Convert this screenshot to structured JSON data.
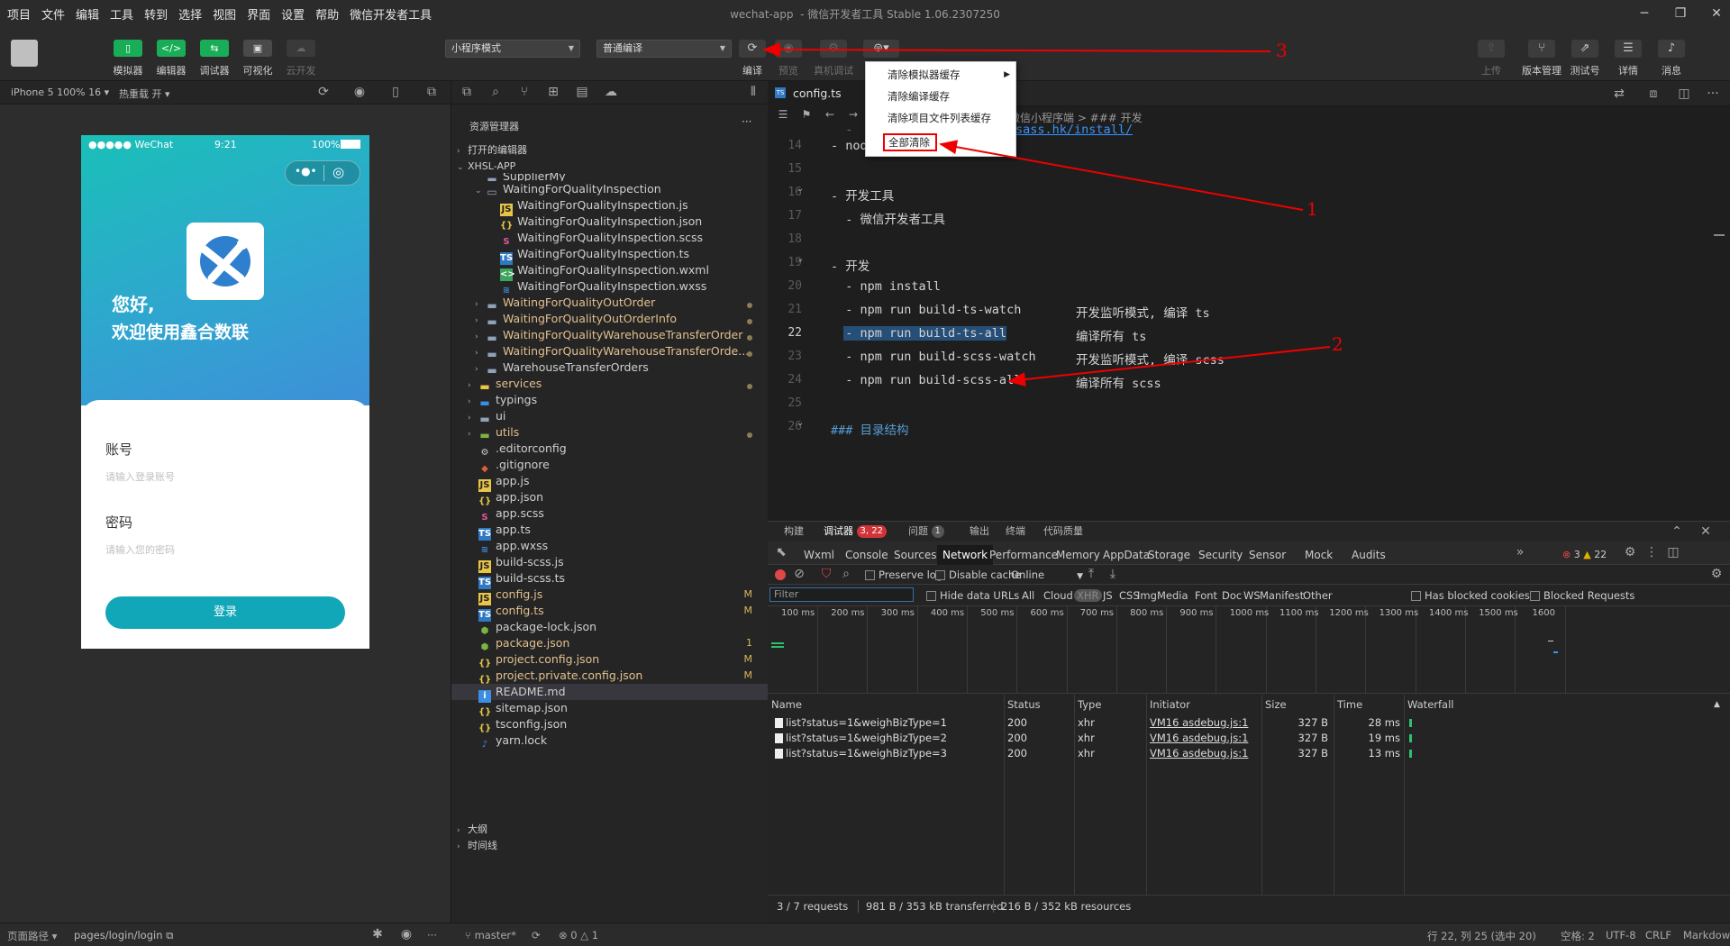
{
  "menubar": {
    "items": [
      "项目",
      "文件",
      "编辑",
      "工具",
      "转到",
      "选择",
      "视图",
      "界面",
      "设置",
      "帮助",
      "微信开发者工具"
    ]
  },
  "window_title": "wechat-app",
  "window_subtitle": "- 微信开发者工具 Stable 1.06.2307250",
  "toolbar": {
    "buttons": [
      "模拟器",
      "编辑器",
      "调试器",
      "可视化",
      "云开发"
    ],
    "mode_select": "小程序模式",
    "compile_select": "普通编译",
    "compile_label": "编译",
    "preview_label": "预览",
    "realdevice_label": "真机调试",
    "right": [
      "上传",
      "版本管理",
      "测试号",
      "详情",
      "消息"
    ]
  },
  "sim": {
    "device": "iPhone 5 100% 16",
    "hotreload": "热重载 开",
    "status_carrier": "●●●●● WeChat",
    "status_time": "9:21",
    "status_battery": "100%",
    "greeting1": "您好,",
    "greeting2": "欢迎使用鑫合数联",
    "account_label": "账号",
    "account_placeholder": "请输入登录账号",
    "password_label": "密码",
    "password_placeholder": "请输入您的密码",
    "login": "登录"
  },
  "explorer": {
    "title": "资源管理器",
    "open_editors": "打开的编辑器",
    "project": "XHSL-APP",
    "outline": "大纲",
    "timeline": "时间线"
  },
  "files": [
    {
      "name": "SupplierMy",
      "indent": 2,
      "icon": "folder",
      "cut": true
    },
    {
      "name": "WaitingForQualityInspection",
      "indent": 2,
      "icon": "folder-open",
      "tw": "v"
    },
    {
      "name": "WaitingForQualityInspection.js",
      "indent": 4,
      "icon": "js"
    },
    {
      "name": "WaitingForQualityInspection.json",
      "indent": 4,
      "icon": "json"
    },
    {
      "name": "WaitingForQualityInspection.scss",
      "indent": 4,
      "icon": "scss"
    },
    {
      "name": "WaitingForQualityInspection.ts",
      "indent": 4,
      "icon": "ts"
    },
    {
      "name": "WaitingForQualityInspection.wxml",
      "indent": 4,
      "icon": "wxml"
    },
    {
      "name": "WaitingForQualityInspection.wxss",
      "indent": 4,
      "icon": "wxss"
    },
    {
      "name": "WaitingForQualityOutOrder",
      "indent": 2,
      "icon": "folder",
      "tw": ">",
      "mod": "dot",
      "color": "yel"
    },
    {
      "name": "WaitingForQualityOutOrderInfo",
      "indent": 2,
      "icon": "folder",
      "tw": ">",
      "mod": "dot",
      "color": "yel"
    },
    {
      "name": "WaitingForQualityWarehouseTransferOrder",
      "indent": 2,
      "icon": "folder",
      "tw": ">",
      "mod": "dot",
      "color": "yel"
    },
    {
      "name": "WaitingForQualityWarehouseTransferOrde...",
      "indent": 2,
      "icon": "folder",
      "tw": ">",
      "mod": "dot",
      "color": "yel"
    },
    {
      "name": "WarehouseTransferOrders",
      "indent": 2,
      "icon": "folder",
      "tw": ">"
    },
    {
      "name": "services",
      "indent": 1,
      "icon": "folder-y",
      "tw": ">",
      "mod": "dot",
      "color": "yel"
    },
    {
      "name": "typings",
      "indent": 1,
      "icon": "folder-b",
      "tw": ">"
    },
    {
      "name": "ui",
      "indent": 1,
      "icon": "folder",
      "tw": ">"
    },
    {
      "name": "utils",
      "indent": 1,
      "icon": "folder-g",
      "tw": ">",
      "mod": "dot",
      "color": "yel"
    },
    {
      "name": ".editorconfig",
      "indent": 1,
      "icon": "cfg"
    },
    {
      "name": ".gitignore",
      "indent": 1,
      "icon": "git"
    },
    {
      "name": "app.js",
      "indent": 1,
      "icon": "js"
    },
    {
      "name": "app.json",
      "indent": 1,
      "icon": "json"
    },
    {
      "name": "app.scss",
      "indent": 1,
      "icon": "scss"
    },
    {
      "name": "app.ts",
      "indent": 1,
      "icon": "ts"
    },
    {
      "name": "app.wxss",
      "indent": 1,
      "icon": "wxss"
    },
    {
      "name": "build-scss.js",
      "indent": 1,
      "icon": "js"
    },
    {
      "name": "build-scss.ts",
      "indent": 1,
      "icon": "ts"
    },
    {
      "name": "config.js",
      "indent": 1,
      "icon": "js",
      "mod": "M",
      "color": "yel"
    },
    {
      "name": "config.ts",
      "indent": 1,
      "icon": "ts",
      "mod": "M",
      "color": "yel"
    },
    {
      "name": "package-lock.json",
      "indent": 1,
      "icon": "npm"
    },
    {
      "name": "package.json",
      "indent": 1,
      "icon": "npm",
      "mod": "1",
      "color": "yel"
    },
    {
      "name": "project.config.json",
      "indent": 1,
      "icon": "json",
      "mod": "M",
      "color": "yel"
    },
    {
      "name": "project.private.config.json",
      "indent": 1,
      "icon": "json",
      "mod": "M",
      "color": "yel"
    },
    {
      "name": "README.md",
      "indent": 1,
      "icon": "info",
      "sel": true
    },
    {
      "name": "sitemap.json",
      "indent": 1,
      "icon": "json"
    },
    {
      "name": "tsconfig.json",
      "indent": 1,
      "icon": "json"
    },
    {
      "name": "yarn.lock",
      "indent": 1,
      "icon": "yarn"
    }
  ],
  "editor": {
    "tab": "config.ts",
    "crumb": "微信小程序端 > ### 开发",
    "partial_link": "www.sass.hk/install/",
    "lines": [
      {
        "n": "14",
        "t": "- node"
      },
      {
        "n": "15",
        "t": ""
      },
      {
        "n": "16",
        "t": "- 开发工具",
        "fold": true
      },
      {
        "n": "17",
        "t": "  - 微信开发者工具"
      },
      {
        "n": "18",
        "t": ""
      },
      {
        "n": "19",
        "t": "- 开发",
        "fold": true
      },
      {
        "n": "20",
        "t": "  - npm install"
      },
      {
        "n": "21",
        "t": "  - npm run build-ts-watch",
        "c": "开发监听模式, 编译 ts"
      },
      {
        "n": "22",
        "t": "  - npm run build-ts-all",
        "c": "编译所有 ts",
        "cur": true
      },
      {
        "n": "23",
        "t": "  - npm run build-scss-watch",
        "c": "开发监听模式, 编译 scss"
      },
      {
        "n": "24",
        "t": "  - npm run build-scss-all",
        "c": "编译所有 scss"
      },
      {
        "n": "25",
        "t": ""
      },
      {
        "n": "26",
        "t": "### 目录结构",
        "fold": true,
        "hd": true
      }
    ]
  },
  "ctxmenu": {
    "items": [
      "清除模拟器缓存",
      "清除编译缓存",
      "清除项目文件列表缓存"
    ],
    "clear_all": "全部清除"
  },
  "devtools": {
    "tabs": [
      "构建",
      "调试器",
      "问题",
      "输出",
      "终端",
      "代码质量"
    ],
    "debugger_badge": "3, 22",
    "problems_badge": "1",
    "panels": [
      "Wxml",
      "Console",
      "Sources",
      "Network",
      "Performance",
      "Memory",
      "AppData",
      "Storage",
      "Security",
      "Sensor",
      "Mock",
      "Audits"
    ],
    "err_count": "3",
    "warn_count": "22",
    "preserve_log": "Preserve log",
    "disable_cache": "Disable cache",
    "online": "Online",
    "filter_placeholder": "Filter",
    "hide_data_urls": "Hide data URLs",
    "types": [
      "All",
      "Cloud",
      "XHR",
      "JS",
      "CSS",
      "Img",
      "Media",
      "Font",
      "Doc",
      "WS",
      "Manifest",
      "Other"
    ],
    "has_blocked": "Has blocked cookies",
    "blocked_requests": "Blocked Requests",
    "ticks": [
      "100 ms",
      "200 ms",
      "300 ms",
      "400 ms",
      "500 ms",
      "600 ms",
      "700 ms",
      "800 ms",
      "900 ms",
      "1000 ms",
      "1100 ms",
      "1200 ms",
      "1300 ms",
      "1400 ms",
      "1500 ms",
      "1600"
    ],
    "columns": [
      "Name",
      "Status",
      "Type",
      "Initiator",
      "Size",
      "Time",
      "Waterfall"
    ],
    "rows": [
      {
        "name": "list?status=1&weighBizType=1",
        "status": "200",
        "type": "xhr",
        "init": "VM16 asdebug.js:1",
        "size": "327 B",
        "time": "28 ms"
      },
      {
        "name": "list?status=1&weighBizType=2",
        "status": "200",
        "type": "xhr",
        "init": "VM16 asdebug.js:1",
        "size": "327 B",
        "time": "19 ms"
      },
      {
        "name": "list?status=1&weighBizType=3",
        "status": "200",
        "type": "xhr",
        "init": "VM16 asdebug.js:1",
        "size": "327 B",
        "time": "13 ms"
      }
    ],
    "summary1": "3 / 7 requests",
    "summary2": "981 B / 353 kB transferred",
    "summary3": "216 B / 352 kB resources"
  },
  "statusbar": {
    "page_path_label": "页面路径",
    "page_path": "pages/login/login",
    "branch": "master*",
    "errors": "0",
    "warnings": "1",
    "cursor": "行 22, 列 25 (选中 20)",
    "spaces": "空格: 2",
    "encoding": "UTF-8",
    "eol": "CRLF",
    "lang": "Markdown"
  },
  "annotations": [
    "1",
    "2",
    "3"
  ]
}
